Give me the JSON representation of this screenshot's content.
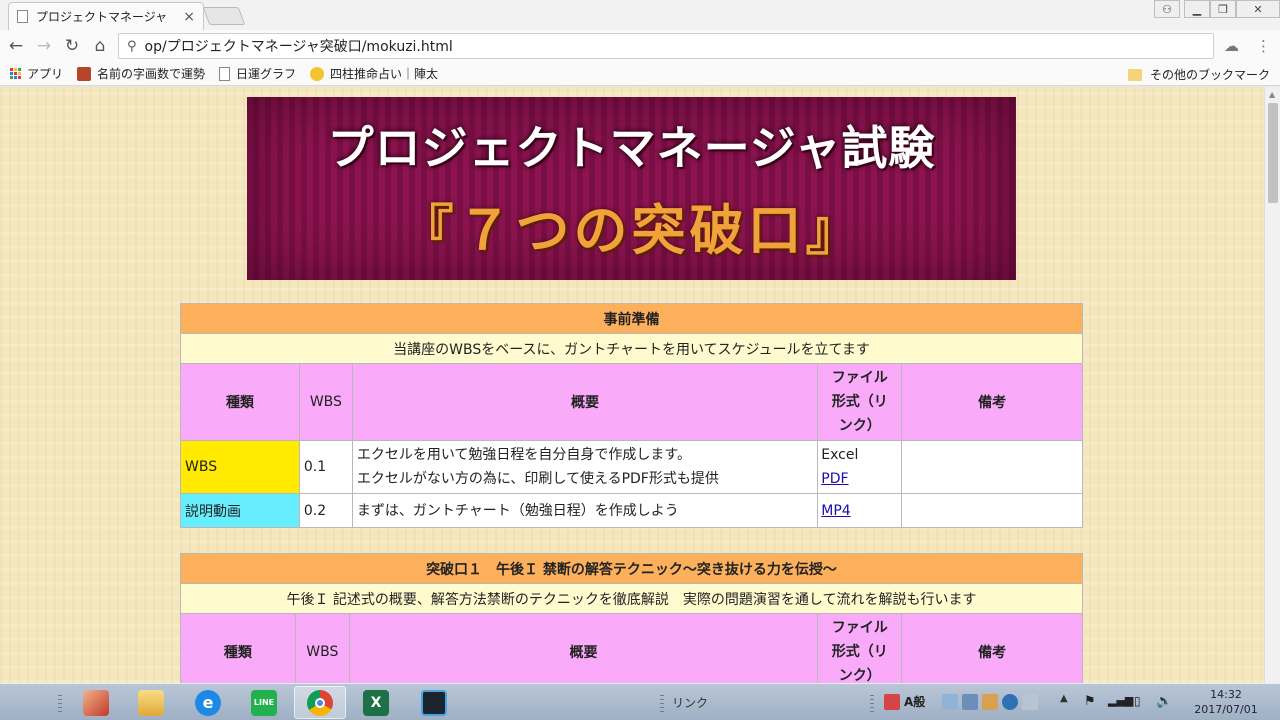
{
  "browser": {
    "tab_title": "プロジェクトマネージャ",
    "tab_close": "×",
    "url": "op/プロジェクトマネージャ突破口/mokuzi.html",
    "bookmarks": [
      {
        "label": "アプリ",
        "icon": "apps-grid-icon"
      },
      {
        "label": "名前の字画数で運勢",
        "icon": "bookmark-red-icon"
      },
      {
        "label": "日運グラフ",
        "icon": "page-icon"
      },
      {
        "label": "四柱推命占い｜陣太",
        "icon": "face-icon"
      }
    ],
    "other_bookmarks": "その他のブックマーク"
  },
  "banner": {
    "line1": "プロジェクトマネージャ試験",
    "line2": "『７つの突破口』"
  },
  "sections": [
    {
      "title": "事前準備",
      "subtitle": "当講座のWBSをベースに、ガントチャートを用いてスケジュールを立てます",
      "columns": {
        "type": "種類",
        "wbs": "WBS",
        "summary": "概要",
        "format": "ファイル形式（リンク）",
        "format_l1": "ファイル",
        "format_l2": "形式（リ",
        "format_l3": "ンク）",
        "notes": "備考"
      },
      "rows": [
        {
          "type": "WBS",
          "wbs": "0.1",
          "summary_l1": "エクセルを用いて勉強日程を自分自身で作成します。",
          "summary_l2": "エクセルがない方の為に、印刷して使えるPDF形式も提供",
          "format_text": "Excel",
          "format_link": "PDF",
          "notes": ""
        },
        {
          "type": "説明動画",
          "wbs": "0.2",
          "summary_l1": "まずは、ガントチャート（勉強日程）を作成しよう",
          "format_link": "MP4",
          "notes": ""
        }
      ]
    },
    {
      "title": "突破口１　午後Ｉ 禁断の解答テクニック～突き抜ける力を伝授～",
      "subtitle": "午後Ｉ 記述式の概要、解答方法禁断のテクニックを徹底解説　実際の問題演習を通して流れを解説も行います",
      "columns": {
        "type": "種類",
        "wbs": "WBS",
        "summary": "概要",
        "format_l1": "ファイル",
        "format_l2": "形式（リ",
        "format_l3": "ンク）",
        "notes": "備考"
      }
    }
  ],
  "taskbar": {
    "link_toolbar": "リンク",
    "ime_label": "A般",
    "time": "14:32",
    "date": "2017/07/01",
    "apps": [
      "photo-app-icon",
      "explorer-folder-icon",
      "internet-explorer-icon",
      "line-app-icon",
      "chrome-icon",
      "excel-icon",
      "media-app-icon"
    ]
  }
}
